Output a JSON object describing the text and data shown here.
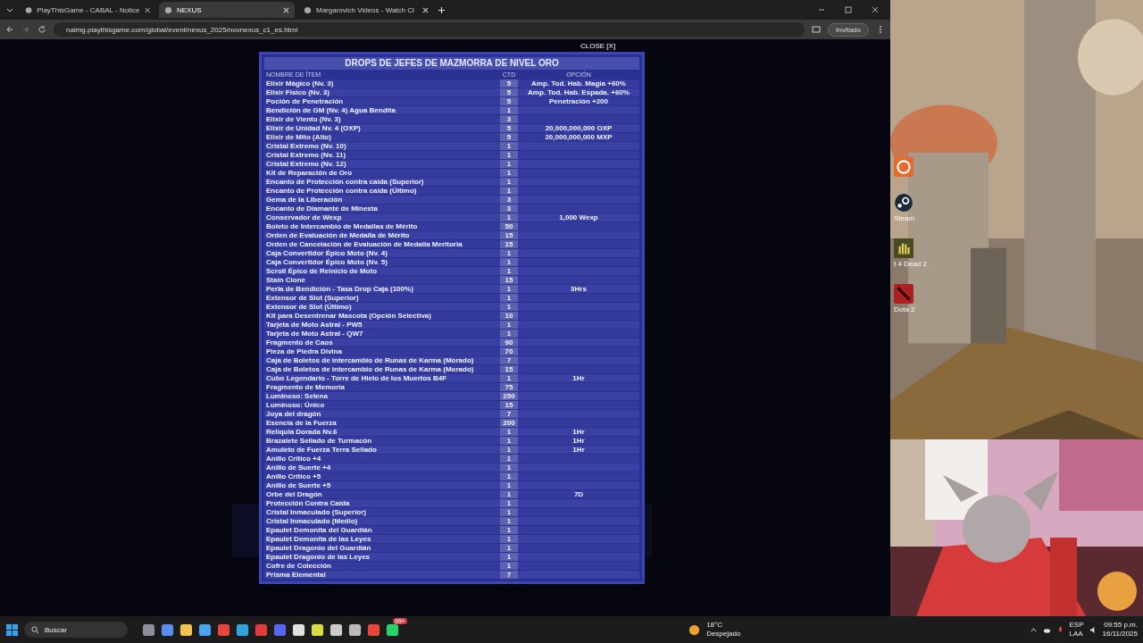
{
  "browser": {
    "tabs": [
      {
        "title": "PlayThisGame - CABAL - Notice",
        "selected": false
      },
      {
        "title": "NEXUS",
        "selected": true
      },
      {
        "title": "Margarovich Videos - Watch Cl",
        "selected": false
      }
    ],
    "url": "naimg.playthisgame.com/global/event/nexus_2025/novnexus_c1_es.html",
    "profile": "Invitado"
  },
  "modal": {
    "close": "CLOSE [X]",
    "title": "DROPS DE JEFES DE MAZMORRA DE NIVEL ORO",
    "columns": [
      "NOMBRE DE ÍTEM",
      "CTD",
      "OPCIÓN"
    ],
    "rows": [
      {
        "name": "Elixir Mágico (Nv. 3)",
        "qty": "5",
        "option": "Amp. Tod. Hab. Magia +60%"
      },
      {
        "name": "Elixir Físico (Nv. 3)",
        "qty": "5",
        "option": "Amp. Tod. Hab. Espada. +60%"
      },
      {
        "name": "Poción de Penetración",
        "qty": "5",
        "option": "Penetración +200"
      },
      {
        "name": "Bendición de GM (Nv. 4) Agua Bendita",
        "qty": "1"
      },
      {
        "name": "Elixir de Viento (Nv. 3)",
        "qty": "3"
      },
      {
        "name": "Elixir de Unidad Nv. 4 (OXP)",
        "qty": "5",
        "option": "20,000,000,000 OXP"
      },
      {
        "name": "Elixir de Mito (Alto)",
        "qty": "5",
        "option": "20,000,000,000 MXP"
      },
      {
        "name": "Cristal Extremo (Nv. 10)",
        "qty": "1"
      },
      {
        "name": "Cristal Extremo (Nv. 11)",
        "qty": "1"
      },
      {
        "name": "Cristal Extremo (Nv. 12)",
        "qty": "1"
      },
      {
        "name": "Kit de Reparación de Oro",
        "qty": "1"
      },
      {
        "name": "Encanto de Protección contra caída (Superior)",
        "qty": "1"
      },
      {
        "name": "Encanto de Protección contra caída (Último)",
        "qty": "1"
      },
      {
        "name": "Gema de la Liberación",
        "qty": "3"
      },
      {
        "name": "Encanto de Diamante de Minesta",
        "qty": "3"
      },
      {
        "name": "Conservador de Wexp",
        "qty": "1",
        "option": "1,000 Wexp"
      },
      {
        "name": "Boleto de Intercambio de Medallas de Mérito",
        "qty": "50"
      },
      {
        "name": "Orden de Evaluación de Medalla de Mérito",
        "qty": "15"
      },
      {
        "name": "Orden de Cancelación de Evaluación de Medalla Meritoria",
        "qty": "15"
      },
      {
        "name": "Caja Convertidor Épico Moto (Nv. 4)",
        "qty": "1"
      },
      {
        "name": "Caja Convertidor Épico Moto (Nv. 5)",
        "qty": "1"
      },
      {
        "name": "Scroll Épico de Reinicio de Moto",
        "qty": "1"
      },
      {
        "name": "Stain Clone",
        "qty": "15"
      },
      {
        "name": "Perla de Bendición - Tasa Drop Caja (100%)",
        "qty": "1",
        "option": "3Hrs"
      },
      {
        "name": "Extensor de Slot (Superior)",
        "qty": "1"
      },
      {
        "name": "Extensor de Slot (Último)",
        "qty": "1"
      },
      {
        "name": "Kit para Desentrenar Mascota (Opción Selectiva)",
        "qty": "10"
      },
      {
        "name": "Tarjeta de Moto Astral - PW5",
        "qty": "1"
      },
      {
        "name": "Tarjeta de Moto Astral - QW7",
        "qty": "1"
      },
      {
        "name": "Fragmento de Caos",
        "qty": "90"
      },
      {
        "name": "Pieza de Piedra Divina",
        "qty": "70"
      },
      {
        "name": "Caja de Boletos de intercambio de Runas de Karma (Morado)",
        "qty": "7"
      },
      {
        "name": "Caja de Boletos de intercambio de Runas de Karma (Morado)",
        "qty": "15"
      },
      {
        "name": "Cubo Legendario - Torre de Hielo de los Muertos B4F",
        "qty": "1",
        "option": "1Hr"
      },
      {
        "name": "Fragmento de Memoria",
        "qty": "75"
      },
      {
        "name": "Luminoso: Selena",
        "qty": "250"
      },
      {
        "name": "Luminoso: Único",
        "qty": "15"
      },
      {
        "name": "Joya del dragón",
        "qty": "7"
      },
      {
        "name": "Esencia de la Fuerza",
        "qty": "200"
      },
      {
        "name": "Reliquia Dorada Nv.6",
        "qty": "1",
        "option": "1Hr"
      },
      {
        "name": "Brazalete Sellado de Turmacón",
        "qty": "1",
        "option": "1Hr"
      },
      {
        "name": "Amuleto de Fuerza Terra Sellado",
        "qty": "1",
        "option": "1Hr"
      },
      {
        "name": "Anillo Crítico +4",
        "qty": "1"
      },
      {
        "name": "Anillo de Suerte +4",
        "qty": "1"
      },
      {
        "name": "Anillo Crítico +5",
        "qty": "1"
      },
      {
        "name": "Anillo de Suerte +5",
        "qty": "1"
      },
      {
        "name": "Orbe del Dragón",
        "qty": "1",
        "option": "7D"
      },
      {
        "name": "Protección Contra Caída",
        "qty": "1"
      },
      {
        "name": "Cristal Inmaculado (Superior)",
        "qty": "1"
      },
      {
        "name": "Cristal Inmaculado (Medio)",
        "qty": "1"
      },
      {
        "name": "Epaulet Demonita del Guardián",
        "qty": "1"
      },
      {
        "name": "Epaulet Demonita de las Leyes",
        "qty": "1"
      },
      {
        "name": "Epaulet Dragonio del Guardián",
        "qty": "1"
      },
      {
        "name": "Epaulet Dragonio de las Leyes",
        "qty": "1"
      },
      {
        "name": "Cofre de Colección",
        "qty": "1"
      },
      {
        "name": "Prisma Elemental",
        "qty": "7"
      }
    ]
  },
  "desktop": {
    "icons": [
      {
        "kind": "orange"
      },
      {
        "kind": "steam",
        "label": "Steam"
      },
      {
        "kind": "l4d",
        "label": "t 4 Dead 2"
      },
      {
        "kind": "dota",
        "label": "Dota 2"
      }
    ]
  },
  "taskbar": {
    "search": "Buscar",
    "apps": [
      {
        "kind": "files"
      },
      {
        "kind": "copilot"
      },
      {
        "kind": "folder"
      },
      {
        "kind": "store"
      },
      {
        "kind": "chrome"
      },
      {
        "kind": "edge"
      },
      {
        "kind": "wps"
      },
      {
        "kind": "discord"
      },
      {
        "kind": "game"
      },
      {
        "kind": "chat"
      },
      {
        "kind": "app"
      },
      {
        "kind": "app2"
      },
      {
        "kind": "chrome"
      },
      {
        "kind": "whatsapp",
        "badge": "99+"
      }
    ],
    "weather": {
      "temp": "18°C",
      "desc": "Despejado"
    },
    "lang": [
      "ESP",
      "LAA"
    ],
    "time": "09:55 p.m.",
    "date": "16/11/2025"
  }
}
